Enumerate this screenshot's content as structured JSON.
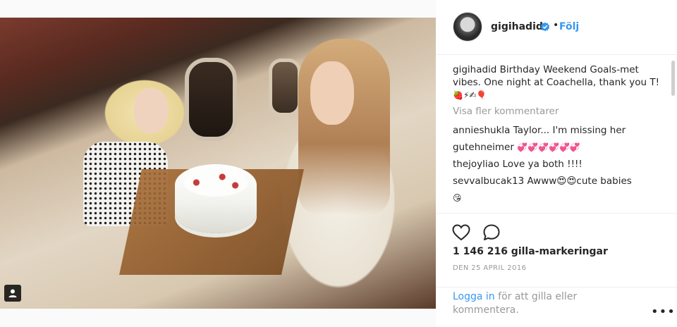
{
  "post": {
    "username": "gigihadid",
    "follow_label": "Följ",
    "separator": "•",
    "caption_user": "gigihadid",
    "caption_text": "Birthday Weekend Goals-met vibes. One night at Coachella, thank you T!",
    "caption_emoji": "🍓⚡✍🎈",
    "show_more_label": "Visa fler kommentarer",
    "comments": [
      {
        "user": "annieshukla",
        "text": "Taylor... I'm missing her"
      },
      {
        "user": "gutehneimer",
        "text": "💞💞💞💞💞💞"
      },
      {
        "user": "thejoyliao",
        "text": "Love ya both !!!!"
      },
      {
        "user": "sevvalbucak13",
        "text": "Awww😍😍cute babies"
      }
    ],
    "extra_emoji": "😘",
    "likes": "1 146 216 gilla-markeringar",
    "date": "DEN 25 APRIL 2016",
    "login_link": "Logga in",
    "login_rest": "för att gilla eller kommentera.",
    "more_options": "•••"
  },
  "icons": {
    "like": "heart-icon",
    "comment": "speech-bubble-icon",
    "verified": "verified-badge-icon",
    "user_tag": "user-tag-icon"
  },
  "colors": {
    "accent": "#3897f0",
    "muted": "#999999",
    "text": "#262626"
  }
}
